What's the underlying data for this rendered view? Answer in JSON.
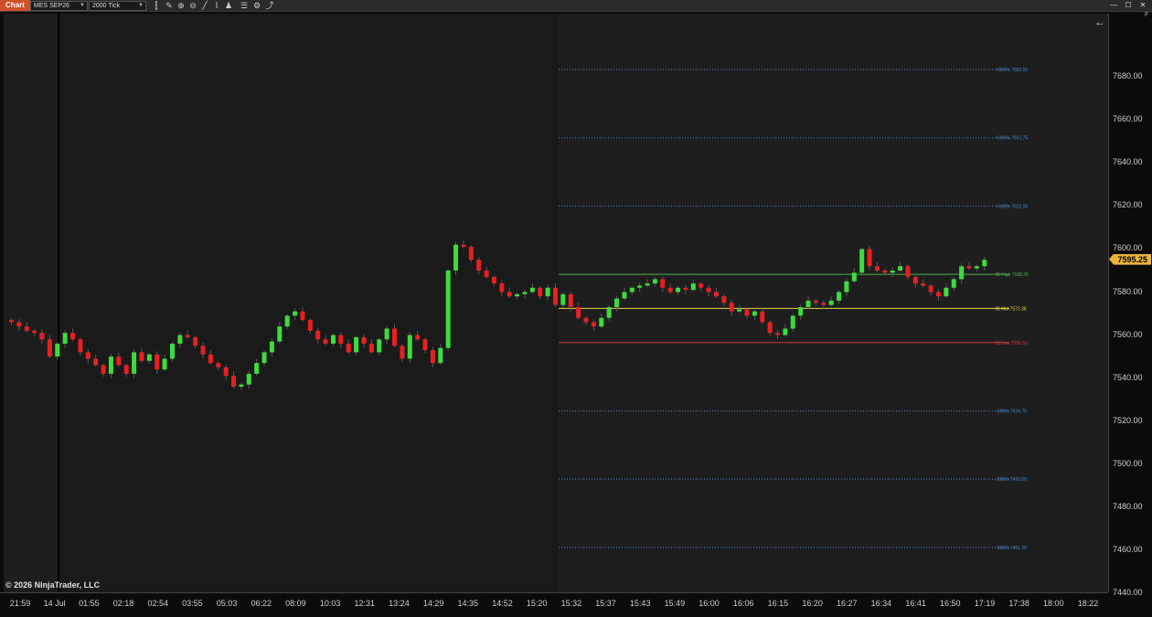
{
  "toolbar": {
    "tab_label": "Chart",
    "instrument": "MES SEP26",
    "interval": "2000 Tick",
    "icons": [
      "bar-type-icon",
      "pencil-icon",
      "zoom-in-icon",
      "zoom-out-icon",
      "drawing-tools-icon",
      "indicators-icon",
      "strategies-icon",
      "properties-icon",
      "templates-icon",
      "share-icon"
    ]
  },
  "window_controls": [
    "minimize",
    "maximize",
    "close"
  ],
  "chart_overlay": {
    "back_arrow": "←",
    "copyright": "© 2026 NinjaTrader, LLC",
    "panel_label": "F"
  },
  "last_price": "7595.25",
  "chart_data": {
    "type": "candlestick",
    "instrument": "MES SEP26",
    "interval": "2000 Tick",
    "ylim": [
      7430,
      7700
    ],
    "y_ticks": [
      7440,
      7460,
      7480,
      7500,
      7520,
      7540,
      7560,
      7580,
      7600,
      7620,
      7640,
      7660,
      7680
    ],
    "y_tick_labels": [
      "7440.00",
      "7460.00",
      "7480.00",
      "7500.00",
      "7520.00",
      "7540.00",
      "7560.00",
      "7580.00",
      "7600.00",
      "7620.00",
      "7640.00",
      "7660.00",
      "7680.00"
    ],
    "x_labels": [
      "21:59",
      "14 Jul",
      "01:55",
      "02:18",
      "02:54",
      "03:55",
      "05:03",
      "06:22",
      "08:09",
      "10:03",
      "12:31",
      "13:24",
      "14:29",
      "14:35",
      "14:52",
      "15:20",
      "15:32",
      "15:37",
      "15:43",
      "15:49",
      "16:00",
      "16:06",
      "16:15",
      "16:20",
      "16:27",
      "16:34",
      "16:41",
      "16:50",
      "17:19",
      "17:38",
      "18:00",
      "18:22"
    ],
    "closes": [
      7566,
      7564,
      7562,
      7561,
      7558,
      7550,
      7556,
      7561,
      7558,
      7552,
      7549,
      7546,
      7542,
      7550,
      7546,
      7542,
      7552,
      7548,
      7551,
      7544,
      7549,
      7556,
      7560,
      7559,
      7555,
      7551,
      7547,
      7545,
      7541,
      7536,
      7537,
      7542,
      7547,
      7552,
      7557,
      7564,
      7569,
      7571,
      7567,
      7562,
      7558,
      7556,
      7560,
      7556,
      7552,
      7559,
      7556,
      7552,
      7558,
      7563,
      7555,
      7549,
      7560,
      7558,
      7553,
      7547,
      7554,
      7590,
      7602,
      7601,
      7595,
      7590,
      7587,
      7584,
      7580,
      7578,
      7579,
      7580,
      7582,
      7578,
      7582,
      7574,
      7579,
      7573,
      7568,
      7566,
      7564,
      7568,
      7573,
      7577,
      7580,
      7582,
      7583,
      7584,
      7586,
      7582,
      7580,
      7582,
      7581,
      7584,
      7582,
      7580,
      7578,
      7575,
      7571,
      7572,
      7569,
      7571,
      7566,
      7561,
      7560,
      7563,
      7569,
      7573,
      7576,
      7575,
      7574,
      7576,
      7580,
      7585,
      7589,
      7600,
      7592,
      7590,
      7589,
      7590,
      7592,
      7587,
      7584,
      7583,
      7580,
      7578,
      7582,
      7586,
      7592,
      7591,
      7592,
      7595
    ],
    "levels": [
      {
        "label": "+300%",
        "value": "7683.50",
        "color": "#4a86c8",
        "style": "dotted"
      },
      {
        "label": "+200%",
        "value": "7651.75",
        "color": "#4a86c8",
        "style": "dotted"
      },
      {
        "label": "+100%",
        "value": "7620.00",
        "color": "#4a86c8",
        "style": "dotted"
      },
      {
        "label": "IB High",
        "value": "7588.25",
        "color": "#4caf50",
        "style": "solid"
      },
      {
        "label": "IB Mid",
        "value": "7572.38",
        "color": "#e6d84a",
        "style": "solid"
      },
      {
        "label": "IB Low",
        "value": "7556.50",
        "color": "#d03a3a",
        "style": "solid"
      },
      {
        "label": "-100%",
        "value": "7524.75",
        "color": "#4a86c8",
        "style": "dotted"
      },
      {
        "label": "-200%",
        "value": "7493.00",
        "color": "#4a86c8",
        "style": "dotted"
      },
      {
        "label": "-300%",
        "value": "7461.25",
        "color": "#4a86c8",
        "style": "dotted"
      }
    ],
    "colors": {
      "up": "#3ddc3d",
      "down": "#e82020",
      "wick": "#5a5a5a",
      "background": "#1a1a1a"
    },
    "grid": false
  }
}
